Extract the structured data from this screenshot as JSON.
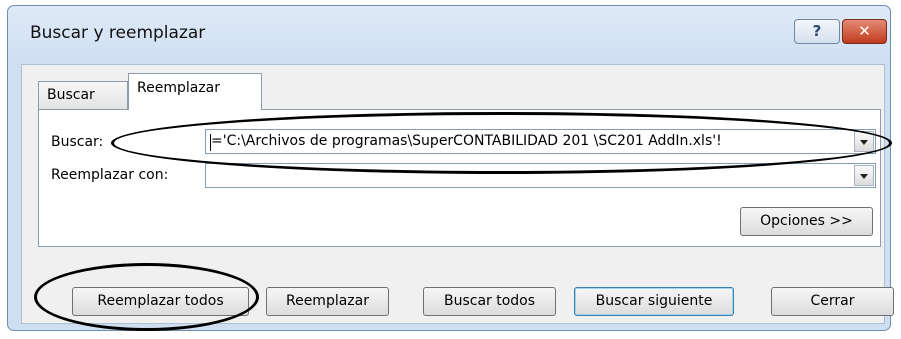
{
  "window": {
    "title": "Buscar y reemplazar",
    "help_glyph": "?",
    "close_glyph": "✕"
  },
  "tabs": [
    {
      "label": "Buscar",
      "selected": false
    },
    {
      "label": "Reemplazar",
      "selected": true
    }
  ],
  "find": {
    "label": "Buscar:",
    "value": "='C:\\Archivos de programas\\SuperCONTABILIDAD 201   \\SC201   AddIn.xls'!"
  },
  "replace": {
    "label": "Reemplazar con:",
    "value": ""
  },
  "buttons": {
    "options": "Opciones >>",
    "replace_all": "Reemplazar todos",
    "replace": "Reemplazar",
    "find_all": "Buscar todos",
    "find_next": "Buscar siguiente",
    "close": "Cerrar"
  },
  "colors": {
    "window_frame": "#6c8db5",
    "close_button": "#c23b1f",
    "default_button_border": "#3c7fb1",
    "annotation_oval": "#000000"
  }
}
